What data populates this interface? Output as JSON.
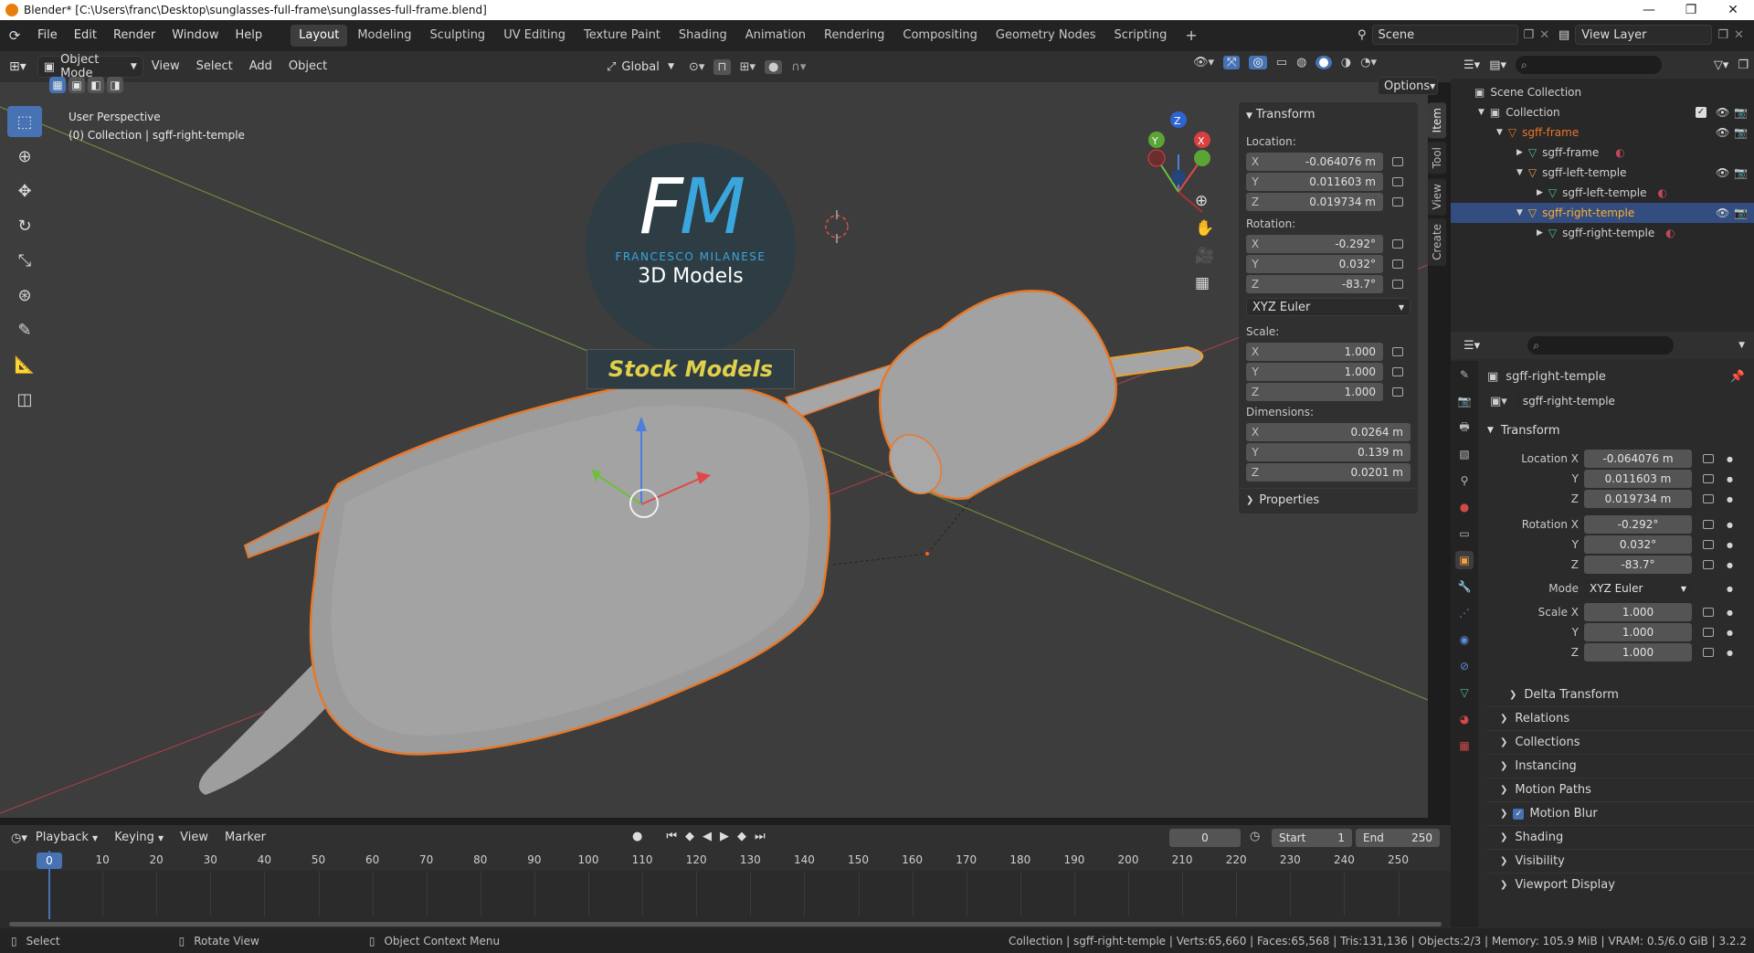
{
  "window": {
    "title": "Blender* [C:\\Users\\franc\\Desktop\\sunglasses-full-frame\\sunglasses-full-frame.blend]",
    "controls": [
      "—",
      "❐",
      "✕"
    ]
  },
  "menus": [
    "File",
    "Edit",
    "Render",
    "Window",
    "Help"
  ],
  "workspaces": [
    "Layout",
    "Modeling",
    "Sculpting",
    "UV Editing",
    "Texture Paint",
    "Shading",
    "Animation",
    "Rendering",
    "Compositing",
    "Geometry Nodes",
    "Scripting"
  ],
  "active_workspace": "Layout",
  "add_workspace": "+",
  "scene": {
    "name": "Scene",
    "view_layer": "View Layer"
  },
  "viewport_header": {
    "mode": "Object Mode",
    "menus": [
      "View",
      "Select",
      "Add",
      "Object"
    ],
    "transform_orientation": "Global",
    "options": "Options"
  },
  "viewport": {
    "info_line1": "User Perspective",
    "info_line2": "(0) Collection | sgff-right-temple",
    "gizmo_axes": [
      "Z",
      "Y",
      "X"
    ],
    "watermark": {
      "logo": "FM",
      "brand": "FRANCESCO MILANESE",
      "sub": "3D Models",
      "banner": "Stock Models"
    }
  },
  "tools": [
    "select-box",
    "cursor",
    "move",
    "rotate",
    "scale",
    "transform",
    "annotate",
    "measure",
    "add-cube"
  ],
  "npanel": {
    "section": "Transform",
    "location_label": "Location:",
    "location": [
      {
        "axis": "X",
        "value": "-0.064076 m"
      },
      {
        "axis": "Y",
        "value": "0.011603 m"
      },
      {
        "axis": "Z",
        "value": "0.019734 m"
      }
    ],
    "rotation_label": "Rotation:",
    "rotation": [
      {
        "axis": "X",
        "value": "-0.292°"
      },
      {
        "axis": "Y",
        "value": "0.032°"
      },
      {
        "axis": "Z",
        "value": "-83.7°"
      }
    ],
    "rotation_mode": "XYZ Euler",
    "scale_label": "Scale:",
    "scale": [
      {
        "axis": "X",
        "value": "1.000"
      },
      {
        "axis": "Y",
        "value": "1.000"
      },
      {
        "axis": "Z",
        "value": "1.000"
      }
    ],
    "dimensions_label": "Dimensions:",
    "dimensions": [
      {
        "axis": "X",
        "value": "0.0264 m"
      },
      {
        "axis": "Y",
        "value": "0.139 m"
      },
      {
        "axis": "Z",
        "value": "0.0201 m"
      }
    ],
    "properties": "Properties",
    "tabs": [
      "Item",
      "Tool",
      "View",
      "Create"
    ]
  },
  "outliner": {
    "rows": [
      {
        "label": "Scene Collection",
        "indent": 0,
        "kind": "scene"
      },
      {
        "label": "Collection",
        "indent": 1,
        "kind": "collection"
      },
      {
        "label": "sgff-frame",
        "indent": 2,
        "kind": "object",
        "orange": true
      },
      {
        "label": "sgff-frame",
        "indent": 3,
        "kind": "mesh"
      },
      {
        "label": "sgff-left-temple",
        "indent": 2,
        "kind": "object"
      },
      {
        "label": "sgff-left-temple",
        "indent": 3,
        "kind": "mesh"
      },
      {
        "label": "sgff-right-temple",
        "indent": 2,
        "kind": "object",
        "selected": true
      },
      {
        "label": "sgff-right-temple",
        "indent": 3,
        "kind": "mesh"
      }
    ]
  },
  "properties": {
    "object_name": "sgff-right-temple",
    "datablock_name": "sgff-right-temple",
    "transform_label": "Transform",
    "location_x_label": "Location X",
    "location": [
      "-0.064076 m",
      "0.011603 m",
      "0.019734 m"
    ],
    "rotation_x_label": "Rotation X",
    "rotation": [
      "-0.292°",
      "0.032°",
      "-83.7°"
    ],
    "mode_label": "Mode",
    "mode": "XYZ Euler",
    "scale_x_label": "Scale X",
    "scale": [
      "1.000",
      "1.000",
      "1.000"
    ],
    "y_label": "Y",
    "z_label": "Z",
    "sections": [
      "Delta Transform",
      "Relations",
      "Collections",
      "Instancing",
      "Motion Paths",
      "Motion Blur",
      "Shading",
      "Visibility",
      "Viewport Display"
    ]
  },
  "timeline": {
    "menus": [
      "Playback",
      "Keying",
      "View",
      "Marker"
    ],
    "current_frame": "0",
    "start_label": "Start",
    "start": "1",
    "end_label": "End",
    "end": "250",
    "ticks": [
      "0",
      "10",
      "20",
      "30",
      "40",
      "50",
      "60",
      "70",
      "80",
      "90",
      "100",
      "110",
      "120",
      "130",
      "140",
      "150",
      "160",
      "170",
      "180",
      "190",
      "200",
      "210",
      "220",
      "230",
      "240",
      "250"
    ]
  },
  "status": {
    "select": "Select",
    "rotate": "Rotate View",
    "context": "Object Context Menu",
    "stats": "Collection | sgff-right-temple | Verts:65,660 | Faces:65,568 | Tris:131,136 | Objects:2/3 | Memory: 105.9 MiB | VRAM: 0.5/6.0 GiB | 3.2.2"
  },
  "colors": {
    "accent": "#4772b3",
    "selection_orange": "#e8782a",
    "active_object": "#ffaf29"
  }
}
